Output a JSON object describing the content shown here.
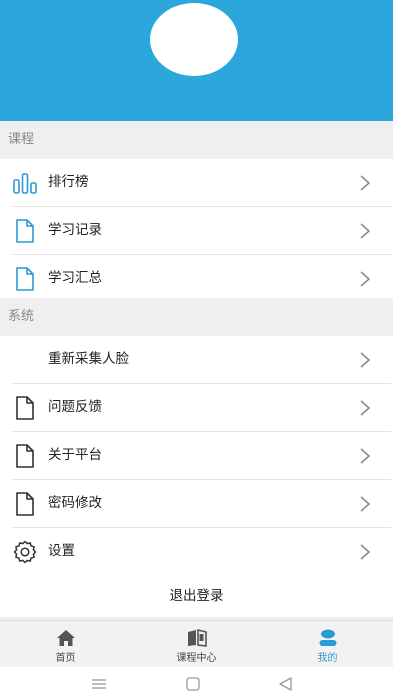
{
  "colors": {
    "header": "#2ca7dc",
    "accent": "#2a9bd4"
  },
  "sections": {
    "course": {
      "title": "课程",
      "items": [
        {
          "label": "排行榜",
          "icon": "bar-chart-icon"
        },
        {
          "label": "学习记录",
          "icon": "document-icon"
        },
        {
          "label": "学习汇总",
          "icon": "document-icon"
        }
      ]
    },
    "system": {
      "title": "系统",
      "items": [
        {
          "label": "重新采集人脸",
          "icon": ""
        },
        {
          "label": "问题反馈",
          "icon": "document-icon"
        },
        {
          "label": "关于平台",
          "icon": "document-icon"
        },
        {
          "label": "密码修改",
          "icon": "document-icon"
        },
        {
          "label": "设置",
          "icon": "gear-icon"
        }
      ]
    }
  },
  "logout_label": "退出登录",
  "tabbar": {
    "tabs": [
      {
        "label": "首页",
        "icon": "home-icon"
      },
      {
        "label": "课程中心",
        "icon": "book-icon"
      },
      {
        "label": "我的",
        "icon": "user-icon",
        "active": true
      }
    ]
  },
  "system_nav": {
    "menu": "menu-icon",
    "home": "square-home-icon",
    "back": "triangle-back-icon"
  }
}
